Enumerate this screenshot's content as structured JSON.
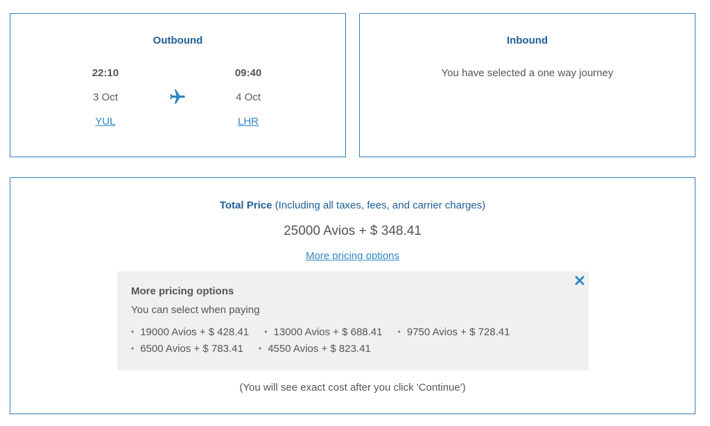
{
  "outbound": {
    "title": "Outbound",
    "departure": {
      "time": "22:10",
      "date": "3 Oct",
      "airport": "YUL"
    },
    "arrival": {
      "time": "09:40",
      "date": "4 Oct",
      "airport": "LHR"
    },
    "icon": "plane-icon"
  },
  "inbound": {
    "title": "Inbound",
    "message": "You have selected a one way journey"
  },
  "price": {
    "total_label": "Total Price",
    "total_note": "(Including all taxes, fees, and carrier charges)",
    "amount": "25000 Avios + $ 348.41",
    "more_link": "More pricing options"
  },
  "options": {
    "title": "More pricing options",
    "subtitle": "You can select when paying",
    "items": [
      "19000 Avios + $ 428.41",
      "13000 Avios + $ 688.41",
      "9750 Avios + $ 728.41",
      "6500 Avios + $ 783.41",
      "4550 Avios + $ 823.41"
    ],
    "close_icon": "close-icon"
  },
  "footnote": "(You will see exact cost after you click 'Continue')",
  "colors": {
    "accent": "#2f86c6",
    "title": "#1f5f95",
    "border": "#2f7fb9",
    "panel_bg": "#f0f0f0"
  }
}
